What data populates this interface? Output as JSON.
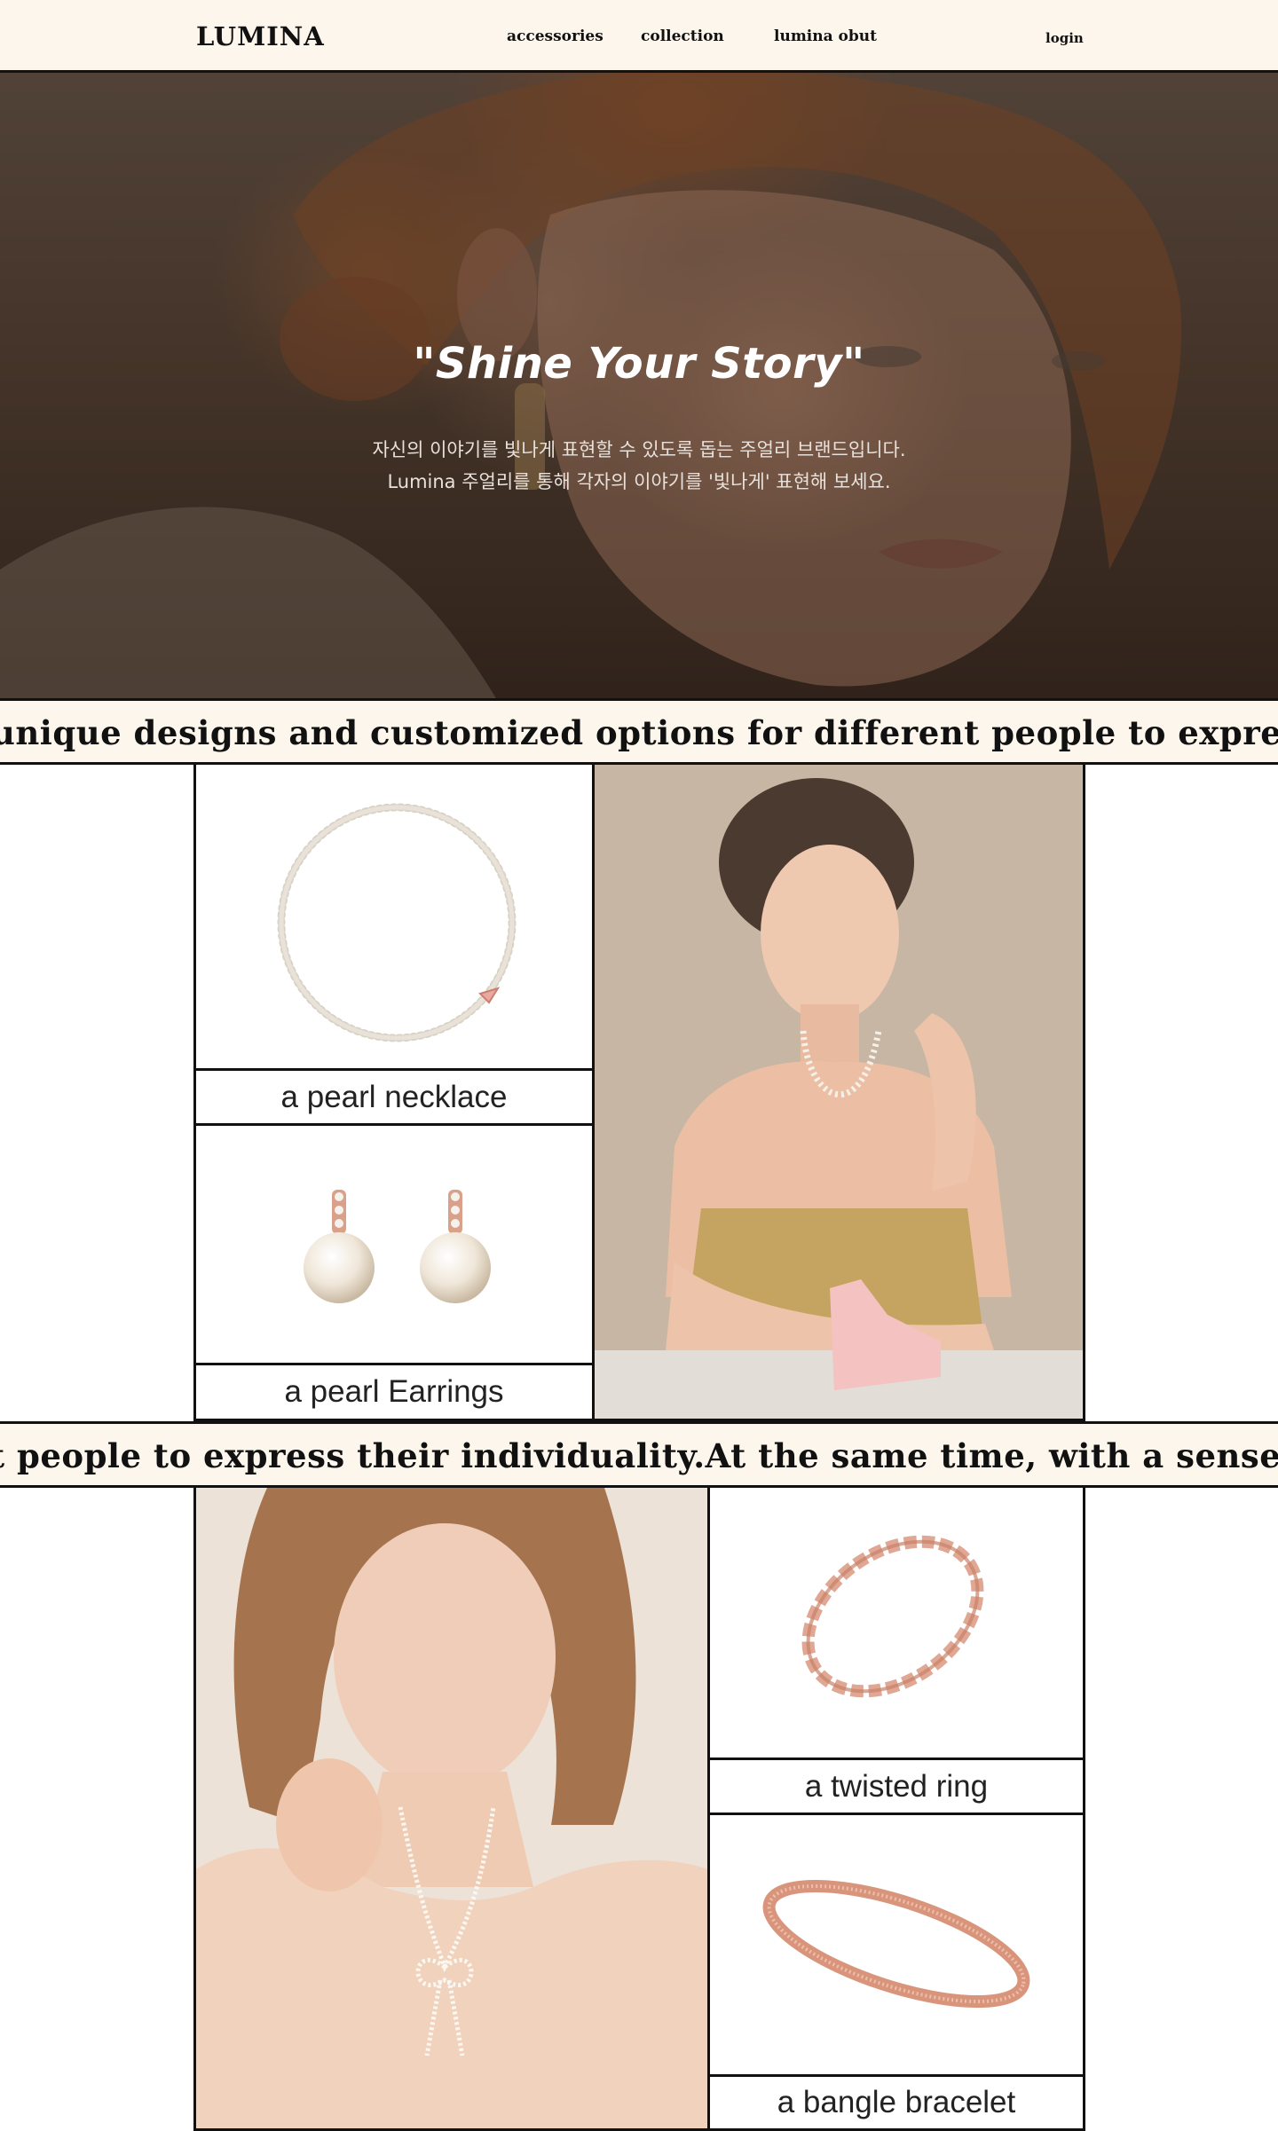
{
  "header": {
    "logo": "LUMINA",
    "nav": [
      "accessories",
      "collection",
      "lumina obut"
    ],
    "login": "login"
  },
  "hero": {
    "title": "\"Shine Your Story\"",
    "subtitle_line1": "자신의 이야기를 빛나게 표현할 수 있도록 돕는 주얼리 브랜드입니다.",
    "subtitle_line2": "Lumina 주얼리를 통해 각자의 이야기를 '빛나게' 표현해 보세요."
  },
  "marquee": {
    "band1": "unique designs and customized options for different people to express",
    "band2": "t people to express their individuality.At the same time, with a sense o"
  },
  "products": [
    {
      "label": "a pearl necklace"
    },
    {
      "label": "a pearl Earrings"
    },
    {
      "label": "a twisted ring"
    },
    {
      "label": "a bangle bracelet"
    }
  ],
  "colors": {
    "cream": "#fdf6ec",
    "ink": "#111111",
    "rose_gold": "#d99a80",
    "pearl": "#f2ece2"
  }
}
